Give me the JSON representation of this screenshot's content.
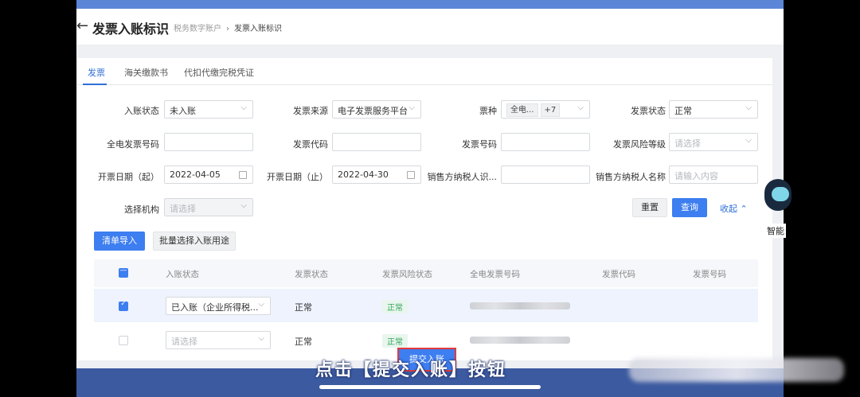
{
  "header": {
    "back_icon": "←",
    "title": "发票入账标识",
    "breadcrumb": [
      "税务数字账户",
      "发票入账标识"
    ]
  },
  "tabs": [
    "发票",
    "海关缴款书",
    "代扣代缴完税凭证"
  ],
  "filters": {
    "entry_status": {
      "label": "入账状态",
      "value": "未入账"
    },
    "invoice_source": {
      "label": "发票来源",
      "value": "电子发票服务平台"
    },
    "ticket_type": {
      "label": "票种",
      "tag": "全电...",
      "more": "+7"
    },
    "invoice_status": {
      "label": "发票状态",
      "value": "正常"
    },
    "full_invoice_no": {
      "label": "全电发票号码",
      "value": ""
    },
    "invoice_code": {
      "label": "发票代码",
      "value": ""
    },
    "invoice_number": {
      "label": "发票号码",
      "value": ""
    },
    "risk_level": {
      "label": "发票风险等级",
      "placeholder": "请选择"
    },
    "date_start": {
      "label": "开票日期（起）",
      "value": "2022-04-05"
    },
    "date_end": {
      "label": "开票日期（止）",
      "value": "2022-04-30"
    },
    "seller_tax_id": {
      "label": "销售方纳税人识...",
      "value": ""
    },
    "seller_name": {
      "label": "销售方纳税人名称",
      "placeholder": "请输入内容"
    },
    "org": {
      "label": "选择机构",
      "placeholder": "请选择"
    }
  },
  "actions": {
    "reset": "重置",
    "query": "查询",
    "collapse": "收起"
  },
  "toolbar": {
    "import": "清单导入",
    "batch": "批量选择入账用途"
  },
  "table": {
    "headers": [
      "入账状态",
      "发票状态",
      "发票风险状态",
      "全电发票号码",
      "发票代码",
      "发票号码"
    ],
    "rows": [
      {
        "checked": true,
        "entry": "已入账（企业所得税...",
        "status": "正常",
        "risk": "正常"
      },
      {
        "checked": false,
        "entry_placeholder": "请选择",
        "status": "正常",
        "risk": "正常"
      }
    ]
  },
  "submit_label": "提交入账",
  "caption": "点击【提交入账】按钮",
  "assistant_label": "智能",
  "colors": {
    "primary": "#3d7ef0",
    "topbar": "#5b86d8",
    "highlight": "#e33a3a",
    "ok": "#35a45b"
  }
}
